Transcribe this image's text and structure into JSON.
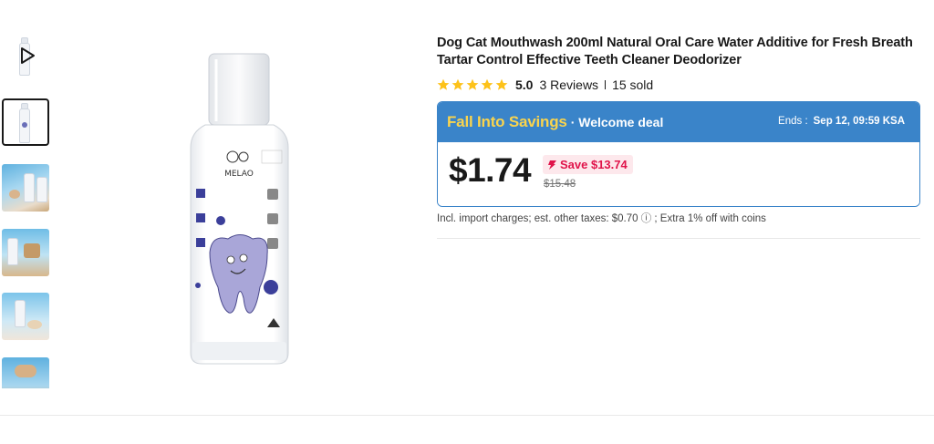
{
  "gallery": {
    "thumbnails": [
      {
        "kind": "video"
      },
      {
        "kind": "image",
        "selected": true
      },
      {
        "kind": "image"
      },
      {
        "kind": "image"
      },
      {
        "kind": "image"
      },
      {
        "kind": "image"
      }
    ],
    "main_image_alt": "MELAO mouthwash bottle",
    "brand_on_label": "MELAO"
  },
  "product": {
    "title": "Dog Cat Mouthwash 200ml Natural Oral Care Water Additive for Fresh Breath Tartar Control Effective Teeth Cleaner Deodorizer",
    "rating": "5.0",
    "stars": 5,
    "reviews": "3 Reviews",
    "sold": "15 sold"
  },
  "deal": {
    "name": "Fall Into Savings",
    "subtitle": "· Welcome deal",
    "ends_label": "Ends :",
    "ends_value": "Sep 12, 09:59 KSA",
    "price": "$1.74",
    "save": "Save $13.74",
    "original_price": "$15.48"
  },
  "import_note": "Incl. import charges; est. other taxes: $0.70 ⓘ ; Extra 1% off with coins",
  "colors": {
    "deal_blue": "#3a84c9",
    "deal_yellow": "#fad44d",
    "star_yellow": "#fdc21a",
    "save_red": "#e0134a",
    "save_bg": "#fde8ec"
  },
  "icons": [
    "play-icon",
    "star-icon",
    "flame-icon",
    "info-icon"
  ]
}
